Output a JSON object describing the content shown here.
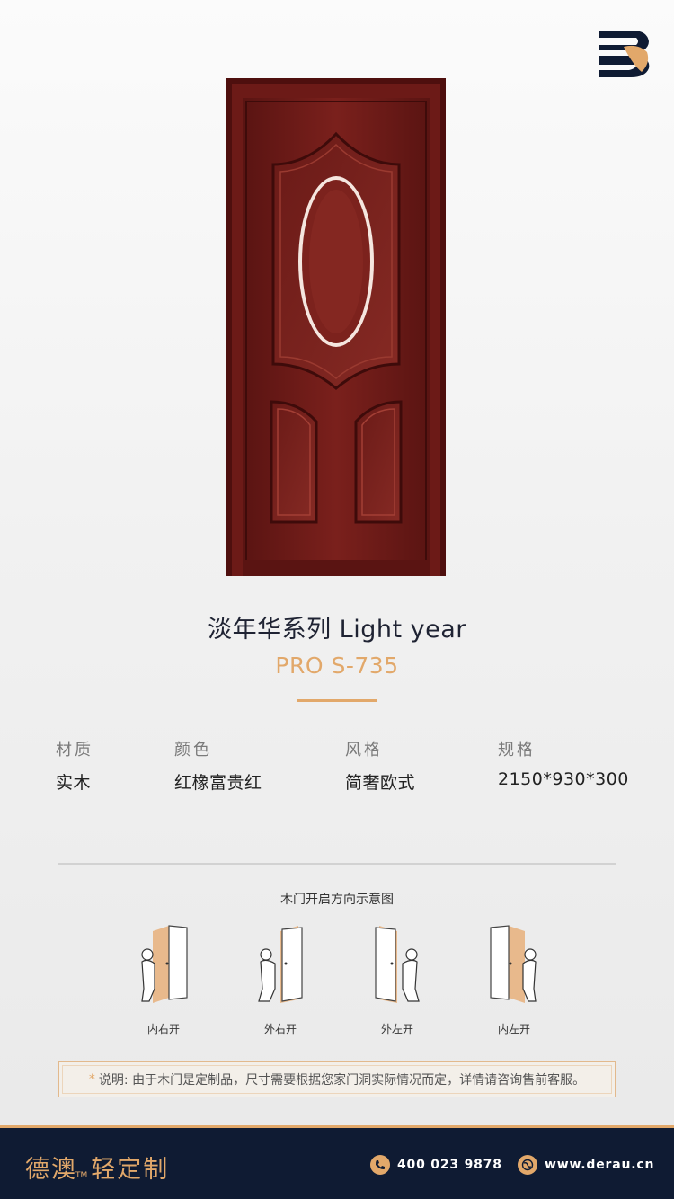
{
  "series_title": "淡年华系列  Light year",
  "model": "PRO S-735",
  "specs": [
    {
      "label": "材质",
      "value": "实木"
    },
    {
      "label": "颜色",
      "value": "红橡富贵红"
    },
    {
      "label": "风格",
      "value": "简奢欧式"
    },
    {
      "label": "规格",
      "value": "2150*930*300"
    }
  ],
  "diagram": {
    "title": "木门开启方向示意图",
    "items": [
      {
        "label": "内右开"
      },
      {
        "label": "外右开"
      },
      {
        "label": "外左开"
      },
      {
        "label": "内左开"
      }
    ]
  },
  "note": {
    "star": "*",
    "text": "说明: 由于木门是定制品，尺寸需要根据您家门洞实际情况而定，详情请咨询售前客服。"
  },
  "footer": {
    "brand": "德澳",
    "tm": "TM",
    "brand_sub": "轻定制",
    "phone": "400 023 9878",
    "website": "www.derau.cn"
  },
  "colors": {
    "accent": "#e2a86a",
    "navy": "#0f1b33",
    "door": "#6e1a18"
  }
}
